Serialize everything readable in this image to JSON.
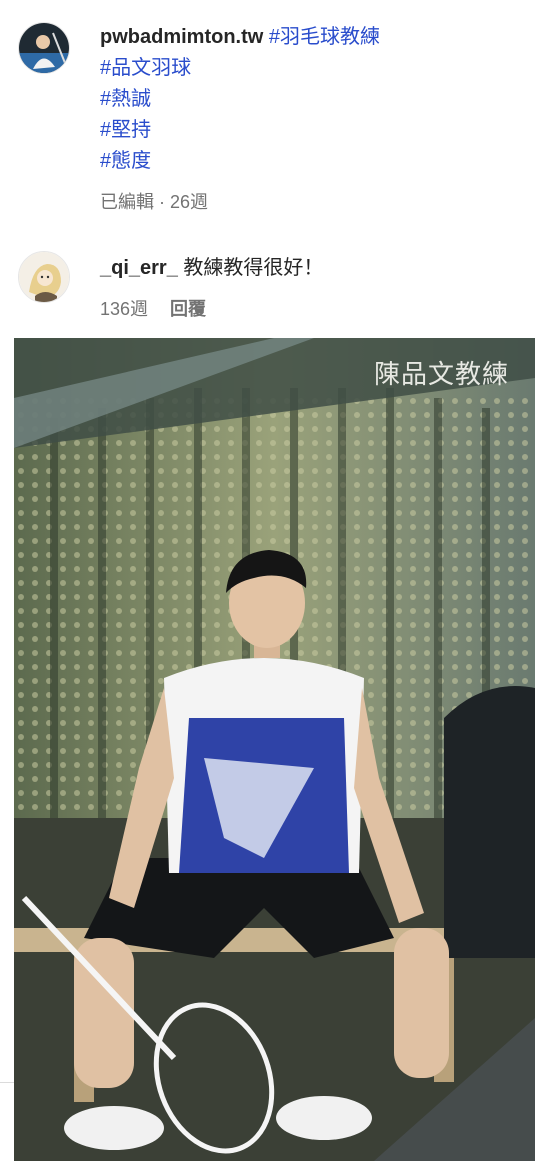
{
  "caption": {
    "username": "pwbadmimton.tw",
    "hashtags": [
      "#羽毛球教練",
      "#品文羽球",
      "#熱誠",
      "#堅持",
      "#態度"
    ],
    "meta": "已編輯 · 26週"
  },
  "reply": {
    "username": "_qi_err_",
    "text": "教練教得很好！",
    "time": "136週",
    "reply_label": "回覆"
  },
  "photo": {
    "watermark": "陳品文教練"
  },
  "colors": {
    "hashtag": "#2a4dcc",
    "muted": "#737373",
    "text": "#262626"
  }
}
